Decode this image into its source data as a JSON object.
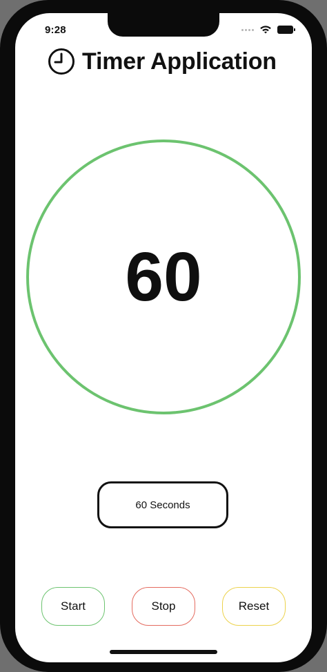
{
  "status_bar": {
    "time": "9:28"
  },
  "header": {
    "title": "Timer Application",
    "icon": "clock-icon"
  },
  "timer": {
    "value": "60",
    "ring_color": "#6cc36f"
  },
  "duration": {
    "label": "60 Seconds"
  },
  "controls": {
    "start_label": "Start",
    "stop_label": "Stop",
    "reset_label": "Reset",
    "start_color": "#6cc36f",
    "stop_color": "#e46a5e",
    "reset_color": "#ecd24b"
  }
}
